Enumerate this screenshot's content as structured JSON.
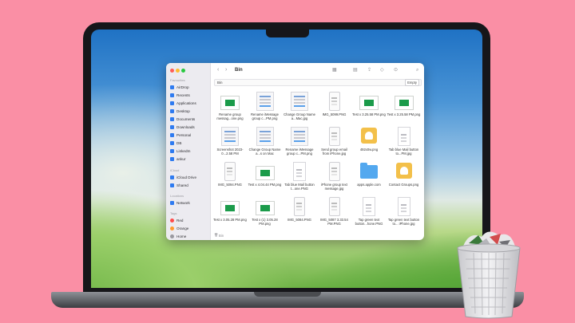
{
  "window": {
    "title": "Bin"
  },
  "pathbar": {
    "label": "Bin",
    "empty_button": "Empty"
  },
  "sidebar": {
    "favourites_header": "Favourites",
    "favourites": [
      {
        "label": "AirDrop",
        "icon": "airdrop-icon"
      },
      {
        "label": "Recents",
        "icon": "clock-icon"
      },
      {
        "label": "Applications",
        "icon": "applications-icon"
      },
      {
        "label": "Desktop",
        "icon": "desktop-icon"
      },
      {
        "label": "Documents",
        "icon": "document-icon"
      },
      {
        "label": "Downloads",
        "icon": "download-icon"
      },
      {
        "label": "Personal",
        "icon": "folder-icon"
      },
      {
        "label": "DB",
        "icon": "folder-icon"
      },
      {
        "label": "LinkedIn",
        "icon": "folder-icon"
      },
      {
        "label": "ankur",
        "icon": "home-icon"
      }
    ],
    "icloud_header": "iCloud",
    "icloud": [
      {
        "label": "iCloud Drive",
        "icon": "cloud-icon"
      },
      {
        "label": "Shared",
        "icon": "shared-folder-icon"
      }
    ],
    "locations_header": "Locations",
    "locations": [
      {
        "label": "Network",
        "icon": "network-icon"
      }
    ],
    "tags_header": "Tags",
    "tags": [
      {
        "label": "Red",
        "color": "#ff4b4b"
      },
      {
        "label": "Orange",
        "color": "#ff9a2e"
      },
      {
        "label": "Home",
        "color": "#9a9aa0"
      }
    ]
  },
  "files": [
    {
      "name": "Rename group messag...one.png",
      "thumb": "green"
    },
    {
      "name": "Rename iMessage group c...PM.png",
      "thumb": "doc"
    },
    {
      "name": "Change Group Name a...Mac.jpg",
      "thumb": "doc"
    },
    {
      "name": "IMG_5099.PNG",
      "thumb": "phone"
    },
    {
      "name": "Test x 3.25.58 PM.png",
      "thumb": "green"
    },
    {
      "name": "Test x 3.25.58 PM.png",
      "thumb": "green"
    },
    {
      "name": "Screenshot 2023-0...2.58 PM",
      "thumb": "doc"
    },
    {
      "name": "Change Group Name a...s on Mac",
      "thumb": "doc"
    },
    {
      "name": "Rename iMessage group c...PM.png",
      "thumb": "doc"
    },
    {
      "name": "Send group email from iPhone.jpg",
      "thumb": "phone"
    },
    {
      "name": "492x0w.png",
      "thumb": "contacts"
    },
    {
      "name": "Tab blue Mail button to...PM.jpg",
      "thumb": "tall"
    },
    {
      "name": "IMG_5094.PNG",
      "thumb": "phone"
    },
    {
      "name": "Test x 4.04.44 PM.png",
      "thumb": "green"
    },
    {
      "name": "Tab blue Mail button t...one.PNG",
      "thumb": "tall"
    },
    {
      "name": "iPhone group text message.jpg",
      "thumb": "phone"
    },
    {
      "name": "apps.apple.com",
      "thumb": "folder"
    },
    {
      "name": "Contact Groups.png",
      "thumb": "contacts"
    },
    {
      "name": "Test x 3.05.28 PM.png",
      "thumb": "green"
    },
    {
      "name": "Test x (1) 3.05.28 PM.png",
      "thumb": "green"
    },
    {
      "name": "IMG_5084.PNG",
      "thumb": "phone"
    },
    {
      "name": "IMG_5087 3.33.54 PM.PNG",
      "thumb": "phone"
    },
    {
      "name": "Tap green text button...hone.PNG",
      "thumb": "tall"
    },
    {
      "name": "Tap green text button to... iPhone.jpg",
      "thumb": "tall"
    }
  ],
  "statusbar": {
    "text": "Bin"
  },
  "colors": {
    "background": "#fa8fa5",
    "accent": "#2f7bf0"
  }
}
